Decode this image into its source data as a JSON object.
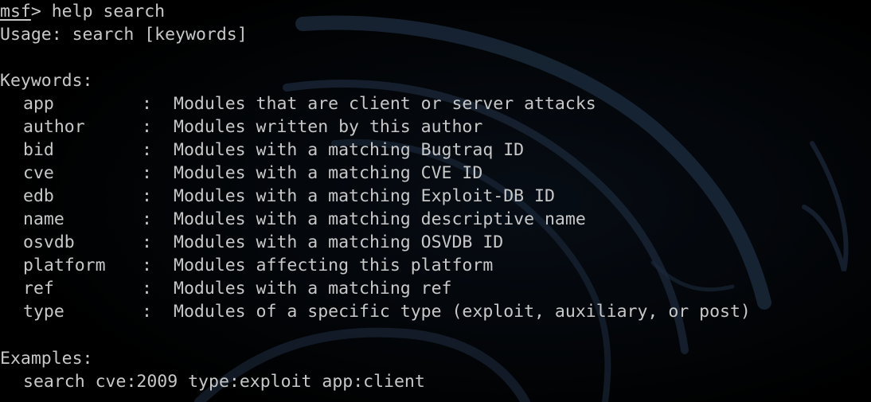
{
  "terminal": {
    "prompt": "msf",
    "prompt_symbol": ">",
    "command": " help search",
    "usage": "Usage: search [keywords]",
    "keywords_heading": "Keywords:",
    "keywords": [
      {
        "name": "app",
        "sep": ":",
        "desc": "Modules that are client or server attacks"
      },
      {
        "name": "author",
        "sep": ":",
        "desc": "Modules written by this author"
      },
      {
        "name": "bid",
        "sep": ":",
        "desc": "Modules with a matching Bugtraq ID"
      },
      {
        "name": "cve",
        "sep": ":",
        "desc": "Modules with a matching CVE ID"
      },
      {
        "name": "edb",
        "sep": ":",
        "desc": "Modules with a matching Exploit-DB ID"
      },
      {
        "name": "name",
        "sep": ":",
        "desc": "Modules with a matching descriptive name"
      },
      {
        "name": "osvdb",
        "sep": ":",
        "desc": "Modules with a matching OSVDB ID"
      },
      {
        "name": "platform",
        "sep": ":",
        "desc": "Modules affecting this platform"
      },
      {
        "name": "ref",
        "sep": ":",
        "desc": "Modules with a matching ref"
      },
      {
        "name": "type",
        "sep": ":",
        "desc": "Modules of a specific type (exploit, auxiliary, or post)"
      }
    ],
    "examples_heading": "Examples:",
    "example": "search cve:2009 type:exploit app:client"
  },
  "colors": {
    "background": "#000000",
    "text": "#c8c8c8",
    "watermark": "#1c2a3c"
  },
  "watermark_icon": "kali-dragon-icon"
}
